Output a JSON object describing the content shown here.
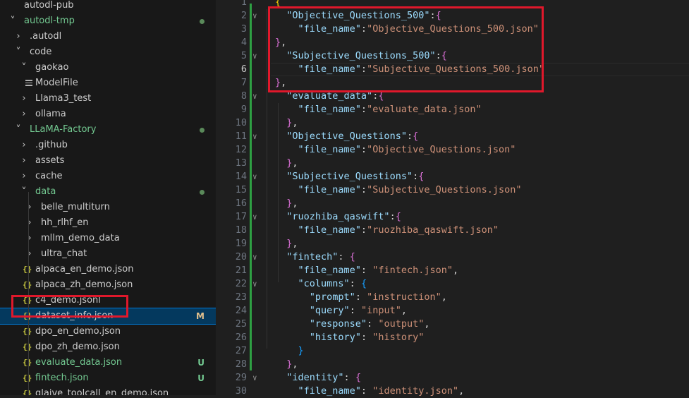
{
  "explorer": {
    "items": [
      {
        "label": "autodl-pub",
        "chevron": "",
        "icon": "none",
        "color": "normal",
        "badge": "",
        "dot": false
      },
      {
        "label": "autodl-tmp",
        "chevron": "down",
        "icon": "none",
        "color": "green",
        "badge": "",
        "dot": true
      },
      {
        "label": ".autodl",
        "chevron": "right",
        "icon": "none",
        "color": "normal",
        "badge": "",
        "dot": false
      },
      {
        "label": "code",
        "chevron": "down",
        "icon": "none",
        "color": "normal",
        "badge": "",
        "dot": false
      },
      {
        "label": "gaokao",
        "chevron": "down",
        "icon": "none",
        "color": "normal",
        "badge": "",
        "dot": false
      },
      {
        "label": "ModelFile",
        "chevron": "",
        "icon": "lines",
        "color": "normal",
        "badge": "",
        "dot": false
      },
      {
        "label": "Llama3_test",
        "chevron": "right",
        "icon": "none",
        "color": "normal",
        "badge": "",
        "dot": false
      },
      {
        "label": "ollama",
        "chevron": "right",
        "icon": "none",
        "color": "normal",
        "badge": "",
        "dot": false
      },
      {
        "label": "LLaMA-Factory",
        "chevron": "down",
        "icon": "none",
        "color": "green",
        "badge": "",
        "dot": true
      },
      {
        "label": ".github",
        "chevron": "right",
        "icon": "none",
        "color": "normal",
        "badge": "",
        "dot": false
      },
      {
        "label": "assets",
        "chevron": "right",
        "icon": "none",
        "color": "normal",
        "badge": "",
        "dot": false
      },
      {
        "label": "cache",
        "chevron": "right",
        "icon": "none",
        "color": "normal",
        "badge": "",
        "dot": false
      },
      {
        "label": "data",
        "chevron": "down",
        "icon": "none",
        "color": "green",
        "badge": "",
        "dot": true
      },
      {
        "label": "belle_multiturn",
        "chevron": "right",
        "icon": "none",
        "color": "normal",
        "badge": "",
        "dot": false
      },
      {
        "label": "hh_rlhf_en",
        "chevron": "right",
        "icon": "none",
        "color": "normal",
        "badge": "",
        "dot": false
      },
      {
        "label": "mllm_demo_data",
        "chevron": "right",
        "icon": "none",
        "color": "normal",
        "badge": "",
        "dot": false
      },
      {
        "label": "ultra_chat",
        "chevron": "right",
        "icon": "none",
        "color": "normal",
        "badge": "",
        "dot": false
      },
      {
        "label": "alpaca_en_demo.json",
        "chevron": "",
        "icon": "json",
        "color": "normal",
        "badge": "",
        "dot": false
      },
      {
        "label": "alpaca_zh_demo.json",
        "chevron": "",
        "icon": "json",
        "color": "normal",
        "badge": "",
        "dot": false
      },
      {
        "label": "c4_demo.jsonl",
        "chevron": "",
        "icon": "json",
        "color": "normal",
        "badge": "",
        "dot": false
      },
      {
        "label": "dataset_info.json",
        "chevron": "",
        "icon": "json",
        "color": "normal",
        "badge": "M",
        "dot": false,
        "selected": true
      },
      {
        "label": "dpo_en_demo.json",
        "chevron": "",
        "icon": "json",
        "color": "normal",
        "badge": "",
        "dot": false
      },
      {
        "label": "dpo_zh_demo.json",
        "chevron": "",
        "icon": "json",
        "color": "normal",
        "badge": "",
        "dot": false
      },
      {
        "label": "evaluate_data.json",
        "chevron": "",
        "icon": "json",
        "color": "green",
        "badge": "U",
        "dot": false
      },
      {
        "label": "fintech.json",
        "chevron": "",
        "icon": "json",
        "color": "green",
        "badge": "U",
        "dot": false
      },
      {
        "label": "glaive_toolcall_en_demo.json",
        "chevron": "",
        "icon": "json",
        "color": "normal",
        "badge": "",
        "dot": false
      }
    ]
  },
  "editor": {
    "active_line": 6,
    "lines": [
      {
        "num": "1",
        "fold": false,
        "tokens": [
          [
            "b0",
            "{"
          ]
        ]
      },
      {
        "num": "2",
        "fold": true,
        "tokens": [
          [
            "p",
            "  "
          ],
          [
            "k",
            "\"Objective_Questions_500\""
          ],
          [
            "p",
            ":"
          ],
          [
            "b1",
            "{"
          ]
        ]
      },
      {
        "num": "3",
        "fold": false,
        "tokens": [
          [
            "p",
            "    "
          ],
          [
            "k",
            "\"file_name\""
          ],
          [
            "p",
            ":"
          ],
          [
            "s",
            "\"Objective_Questions_500.json\""
          ]
        ]
      },
      {
        "num": "4",
        "fold": false,
        "tokens": [
          [
            "b1",
            "}"
          ],
          [
            "p",
            ","
          ]
        ]
      },
      {
        "num": "5",
        "fold": true,
        "tokens": [
          [
            "p",
            "  "
          ],
          [
            "k",
            "\"Subjective_Questions_500\""
          ],
          [
            "p",
            ":"
          ],
          [
            "b1",
            "{"
          ]
        ]
      },
      {
        "num": "6",
        "fold": false,
        "tokens": [
          [
            "p",
            "    "
          ],
          [
            "k",
            "\"file_name\""
          ],
          [
            "p",
            ":"
          ],
          [
            "s",
            "\"Subjective_Questions_500.json\""
          ]
        ]
      },
      {
        "num": "7",
        "fold": false,
        "tokens": [
          [
            "b1",
            "}"
          ],
          [
            "p",
            ","
          ]
        ]
      },
      {
        "num": "8",
        "fold": true,
        "tokens": [
          [
            "p",
            "  "
          ],
          [
            "k",
            "\"evaluate_data\""
          ],
          [
            "p",
            ":"
          ],
          [
            "b1",
            "{"
          ]
        ]
      },
      {
        "num": "9",
        "fold": false,
        "tokens": [
          [
            "p",
            "    "
          ],
          [
            "k",
            "\"file_name\""
          ],
          [
            "p",
            ":"
          ],
          [
            "s",
            "\"evaluate_data.json\""
          ]
        ]
      },
      {
        "num": "10",
        "fold": false,
        "tokens": [
          [
            "p",
            "  "
          ],
          [
            "b1",
            "}"
          ],
          [
            "p",
            ","
          ]
        ]
      },
      {
        "num": "11",
        "fold": true,
        "tokens": [
          [
            "p",
            "  "
          ],
          [
            "k",
            "\"Objective_Questions\""
          ],
          [
            "p",
            ":"
          ],
          [
            "b1",
            "{"
          ]
        ]
      },
      {
        "num": "12",
        "fold": false,
        "tokens": [
          [
            "p",
            "    "
          ],
          [
            "k",
            "\"file_name\""
          ],
          [
            "p",
            ":"
          ],
          [
            "s",
            "\"Objective_Questions.json\""
          ]
        ]
      },
      {
        "num": "13",
        "fold": false,
        "tokens": [
          [
            "p",
            "  "
          ],
          [
            "b1",
            "}"
          ],
          [
            "p",
            ","
          ]
        ]
      },
      {
        "num": "14",
        "fold": true,
        "tokens": [
          [
            "p",
            "  "
          ],
          [
            "k",
            "\"Subjective_Questions\""
          ],
          [
            "p",
            ":"
          ],
          [
            "b1",
            "{"
          ]
        ]
      },
      {
        "num": "15",
        "fold": false,
        "tokens": [
          [
            "p",
            "    "
          ],
          [
            "k",
            "\"file_name\""
          ],
          [
            "p",
            ":"
          ],
          [
            "s",
            "\"Subjective_Questions.json\""
          ]
        ]
      },
      {
        "num": "16",
        "fold": false,
        "tokens": [
          [
            "p",
            "  "
          ],
          [
            "b1",
            "}"
          ],
          [
            "p",
            ","
          ]
        ]
      },
      {
        "num": "17",
        "fold": true,
        "tokens": [
          [
            "p",
            "  "
          ],
          [
            "k",
            "\"ruozhiba_qaswift\""
          ],
          [
            "p",
            ":"
          ],
          [
            "b1",
            "{"
          ]
        ]
      },
      {
        "num": "18",
        "fold": false,
        "tokens": [
          [
            "p",
            "    "
          ],
          [
            "k",
            "\"file_name\""
          ],
          [
            "p",
            ":"
          ],
          [
            "s",
            "\"ruozhiba_qaswift.json\""
          ]
        ]
      },
      {
        "num": "19",
        "fold": false,
        "tokens": [
          [
            "p",
            "  "
          ],
          [
            "b1",
            "}"
          ],
          [
            "p",
            ","
          ]
        ]
      },
      {
        "num": "20",
        "fold": true,
        "tokens": [
          [
            "p",
            "  "
          ],
          [
            "k",
            "\"fintech\""
          ],
          [
            "p",
            ": "
          ],
          [
            "b1",
            "{"
          ]
        ]
      },
      {
        "num": "21",
        "fold": false,
        "tokens": [
          [
            "p",
            "    "
          ],
          [
            "k",
            "\"file_name\""
          ],
          [
            "p",
            ": "
          ],
          [
            "s",
            "\"fintech.json\""
          ],
          [
            "p",
            ","
          ]
        ]
      },
      {
        "num": "22",
        "fold": true,
        "tokens": [
          [
            "p",
            "    "
          ],
          [
            "k",
            "\"columns\""
          ],
          [
            "p",
            ": "
          ],
          [
            "b2",
            "{"
          ]
        ]
      },
      {
        "num": "23",
        "fold": false,
        "tokens": [
          [
            "p",
            "      "
          ],
          [
            "k",
            "\"prompt\""
          ],
          [
            "p",
            ": "
          ],
          [
            "s",
            "\"instruction\""
          ],
          [
            "p",
            ","
          ]
        ]
      },
      {
        "num": "24",
        "fold": false,
        "tokens": [
          [
            "p",
            "      "
          ],
          [
            "k",
            "\"query\""
          ],
          [
            "p",
            ": "
          ],
          [
            "s",
            "\"input\""
          ],
          [
            "p",
            ","
          ]
        ]
      },
      {
        "num": "25",
        "fold": false,
        "tokens": [
          [
            "p",
            "      "
          ],
          [
            "k",
            "\"response\""
          ],
          [
            "p",
            ": "
          ],
          [
            "s",
            "\"output\""
          ],
          [
            "p",
            ","
          ]
        ]
      },
      {
        "num": "26",
        "fold": false,
        "tokens": [
          [
            "p",
            "      "
          ],
          [
            "k",
            "\"history\""
          ],
          [
            "p",
            ": "
          ],
          [
            "s",
            "\"history\""
          ]
        ]
      },
      {
        "num": "27",
        "fold": false,
        "tokens": [
          [
            "p",
            "    "
          ],
          [
            "b2",
            "}"
          ]
        ]
      },
      {
        "num": "28",
        "fold": false,
        "tokens": [
          [
            "p",
            "  "
          ],
          [
            "b1",
            "}"
          ],
          [
            "p",
            ","
          ]
        ]
      },
      {
        "num": "29",
        "fold": true,
        "tokens": [
          [
            "p",
            "  "
          ],
          [
            "k",
            "\"identity\""
          ],
          [
            "p",
            ": "
          ],
          [
            "b1",
            "{"
          ]
        ]
      },
      {
        "num": "30",
        "fold": false,
        "tokens": [
          [
            "p",
            "    "
          ],
          [
            "k",
            "\"file_name\""
          ],
          [
            "p",
            ": "
          ],
          [
            "s",
            "\"identity.json\""
          ],
          [
            "p",
            ","
          ]
        ]
      }
    ]
  }
}
